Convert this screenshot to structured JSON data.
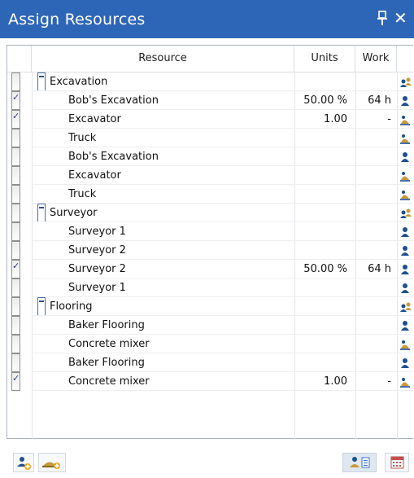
{
  "window": {
    "title": "Assign Resources"
  },
  "table": {
    "columns": {
      "resource": "Resource",
      "units": "Units",
      "work": "Work"
    },
    "rows": [
      {
        "type": "group",
        "checked": false,
        "resource": "Excavation",
        "units": "",
        "work": "",
        "icon": "group-icon"
      },
      {
        "type": "item",
        "checked": true,
        "resource": "Bob's Excavation",
        "units": "50.00 %",
        "work": "64 h",
        "icon": "person-icon"
      },
      {
        "type": "item",
        "checked": true,
        "resource": "Excavator",
        "units": "1.00",
        "work": "-",
        "icon": "material-icon"
      },
      {
        "type": "item",
        "checked": false,
        "resource": "Truck",
        "units": "",
        "work": "",
        "icon": "material-icon"
      },
      {
        "type": "item",
        "checked": false,
        "resource": "Bob's Excavation",
        "units": "",
        "work": "",
        "icon": "person-icon"
      },
      {
        "type": "item",
        "checked": false,
        "resource": "Excavator",
        "units": "",
        "work": "",
        "icon": "material-icon"
      },
      {
        "type": "item",
        "checked": false,
        "resource": "Truck",
        "units": "",
        "work": "",
        "icon": "material-icon"
      },
      {
        "type": "group",
        "checked": false,
        "resource": "Surveyor",
        "units": "",
        "work": "",
        "icon": "group-icon"
      },
      {
        "type": "item",
        "checked": false,
        "resource": "Surveyor 1",
        "units": "",
        "work": "",
        "icon": "person-icon"
      },
      {
        "type": "item",
        "checked": false,
        "resource": "Surveyor 2",
        "units": "",
        "work": "",
        "icon": "person-icon"
      },
      {
        "type": "item",
        "checked": true,
        "resource": "Surveyor 2",
        "units": "50.00 %",
        "work": "64 h",
        "icon": "person-icon"
      },
      {
        "type": "item",
        "checked": false,
        "resource": "Surveyor 1",
        "units": "",
        "work": "",
        "icon": "person-icon"
      },
      {
        "type": "group",
        "checked": false,
        "resource": "Flooring",
        "units": "",
        "work": "",
        "icon": "group-icon"
      },
      {
        "type": "item",
        "checked": false,
        "resource": "Baker Flooring",
        "units": "",
        "work": "",
        "icon": "person-icon"
      },
      {
        "type": "item",
        "checked": false,
        "resource": "Concrete mixer",
        "units": "",
        "work": "",
        "icon": "material-icon"
      },
      {
        "type": "item",
        "checked": false,
        "resource": "Baker Flooring",
        "units": "",
        "work": "",
        "icon": "person-icon"
      },
      {
        "type": "item",
        "checked": true,
        "resource": "Concrete mixer",
        "units": "1.00",
        "work": "-",
        "icon": "material-icon"
      }
    ]
  },
  "toolbar": {
    "buttons": [
      "add-person-resource-icon",
      "add-material-resource-icon",
      "resource-list-icon",
      "calendar-icon"
    ]
  },
  "colors": {
    "titlebar": "#2e66b7",
    "person": "#1f4f8f",
    "material": "#b98a2c"
  }
}
